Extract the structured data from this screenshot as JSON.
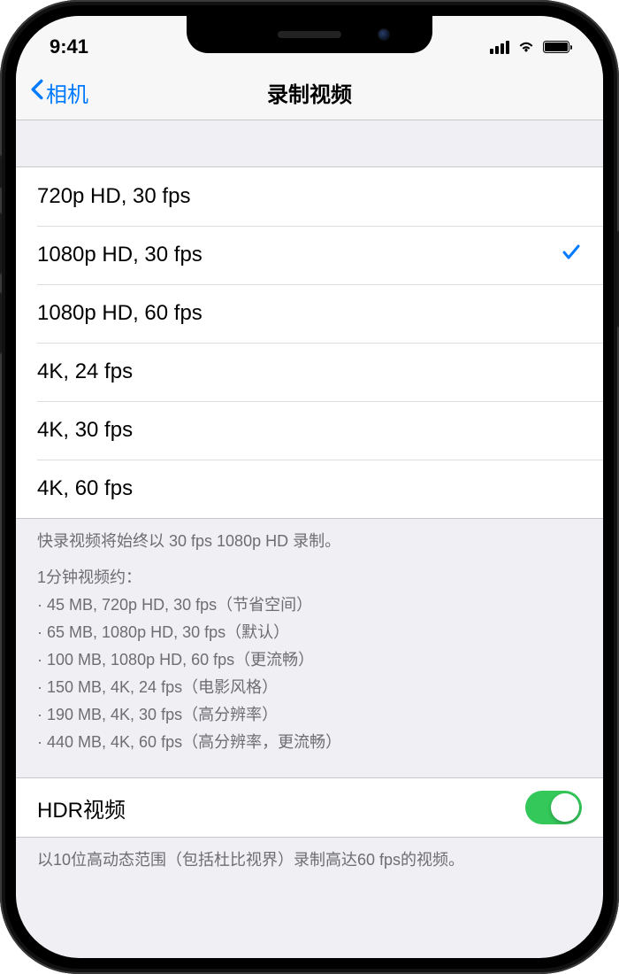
{
  "status": {
    "time": "9:41"
  },
  "nav": {
    "back": "相机",
    "title": "录制视频"
  },
  "options": [
    {
      "label": "720p HD, 30 fps",
      "selected": false
    },
    {
      "label": "1080p HD, 30 fps",
      "selected": true
    },
    {
      "label": "1080p HD, 60 fps",
      "selected": false
    },
    {
      "label": "4K, 24 fps",
      "selected": false
    },
    {
      "label": "4K, 30 fps",
      "selected": false
    },
    {
      "label": "4K, 60 fps",
      "selected": false
    }
  ],
  "footer": {
    "note": "快录视频将始终以 30 fps 1080p HD 录制。",
    "sizes_heading": "1分钟视频约：",
    "sizes": [
      "· 45 MB, 720p HD, 30 fps（节省空间）",
      "· 65 MB, 1080p HD, 30 fps（默认）",
      "· 100 MB, 1080p HD, 60 fps（更流畅）",
      "· 150 MB, 4K, 24 fps（电影风格）",
      "· 190 MB, 4K, 30 fps（高分辨率）",
      "· 440 MB, 4K, 60 fps（高分辨率，更流畅）"
    ]
  },
  "hdr": {
    "label": "HDR视频",
    "on": true,
    "description": "以10位高动态范围（包括杜比视界）录制高达60 fps的视频。"
  }
}
